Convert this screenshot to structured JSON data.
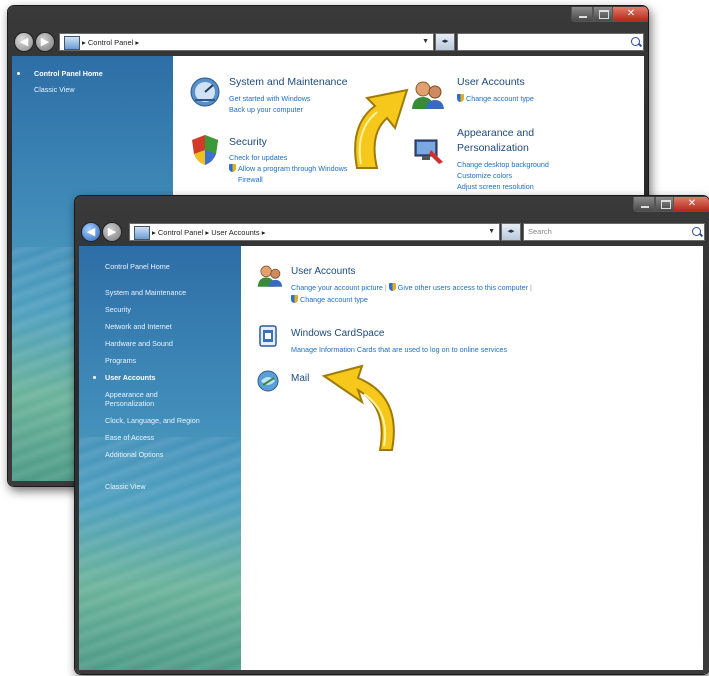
{
  "back_window": {
    "breadcrumb": [
      "Control Panel",
      "▸"
    ],
    "search_placeholder": "",
    "sidebar": {
      "items": [
        {
          "label": "Control Panel Home",
          "bold": true,
          "bullet": true
        },
        {
          "label": "Classic View",
          "bold": false,
          "bullet": false
        }
      ]
    },
    "categories": {
      "system": {
        "title": "System and Maintenance",
        "links": [
          "Get started with Windows",
          "Back up your computer"
        ]
      },
      "security": {
        "title": "Security",
        "links": [
          "Check for updates",
          "Allow a program through Windows",
          "Firewall"
        ]
      },
      "users": {
        "title": "User Accounts",
        "links": [
          "Change account type"
        ]
      },
      "appearance": {
        "title": "Appearance and",
        "title2": "Personalization",
        "links": [
          "Change desktop background",
          "Customize colors",
          "Adjust screen resolution"
        ]
      }
    }
  },
  "front_window": {
    "breadcrumb": [
      "Control Panel",
      "▸",
      "User Accounts",
      "▸"
    ],
    "search_placeholder": "Search",
    "sidebar": {
      "items": [
        {
          "label": "Control Panel Home",
          "bold": false,
          "bullet": false
        },
        {
          "label": "System and Maintenance",
          "bold": false,
          "bullet": false
        },
        {
          "label": "Security",
          "bold": false,
          "bullet": false
        },
        {
          "label": "Network and Internet",
          "bold": false,
          "bullet": false
        },
        {
          "label": "Hardware and Sound",
          "bold": false,
          "bullet": false
        },
        {
          "label": "Programs",
          "bold": false,
          "bullet": false
        },
        {
          "label": "User Accounts",
          "bold": true,
          "bullet": true
        },
        {
          "label": "Appearance and",
          "bold": false,
          "bullet": false
        },
        {
          "label": "Personalization",
          "bold": false,
          "bullet": false
        },
        {
          "label": "Clock, Language, and Region",
          "bold": false,
          "bullet": false
        },
        {
          "label": "Ease of Access",
          "bold": false,
          "bullet": false
        },
        {
          "label": "Additional Options",
          "bold": false,
          "bullet": false
        },
        {
          "label": "Classic View",
          "bold": false,
          "bullet": false
        }
      ]
    },
    "sections": {
      "user_accounts": {
        "title": "User Accounts",
        "link1": "Change your account picture",
        "sep": "|",
        "link2": "Give other users access to this computer",
        "link3": "Change account type"
      },
      "cardspace": {
        "title": "Windows CardSpace",
        "link1": "Manage Information Cards that are used to log on to online services"
      },
      "mail": {
        "title": "Mail"
      }
    }
  },
  "colors": {
    "arrow": "#f2c21a",
    "link": "#1d6fc4",
    "title": "#1d4a7a"
  }
}
